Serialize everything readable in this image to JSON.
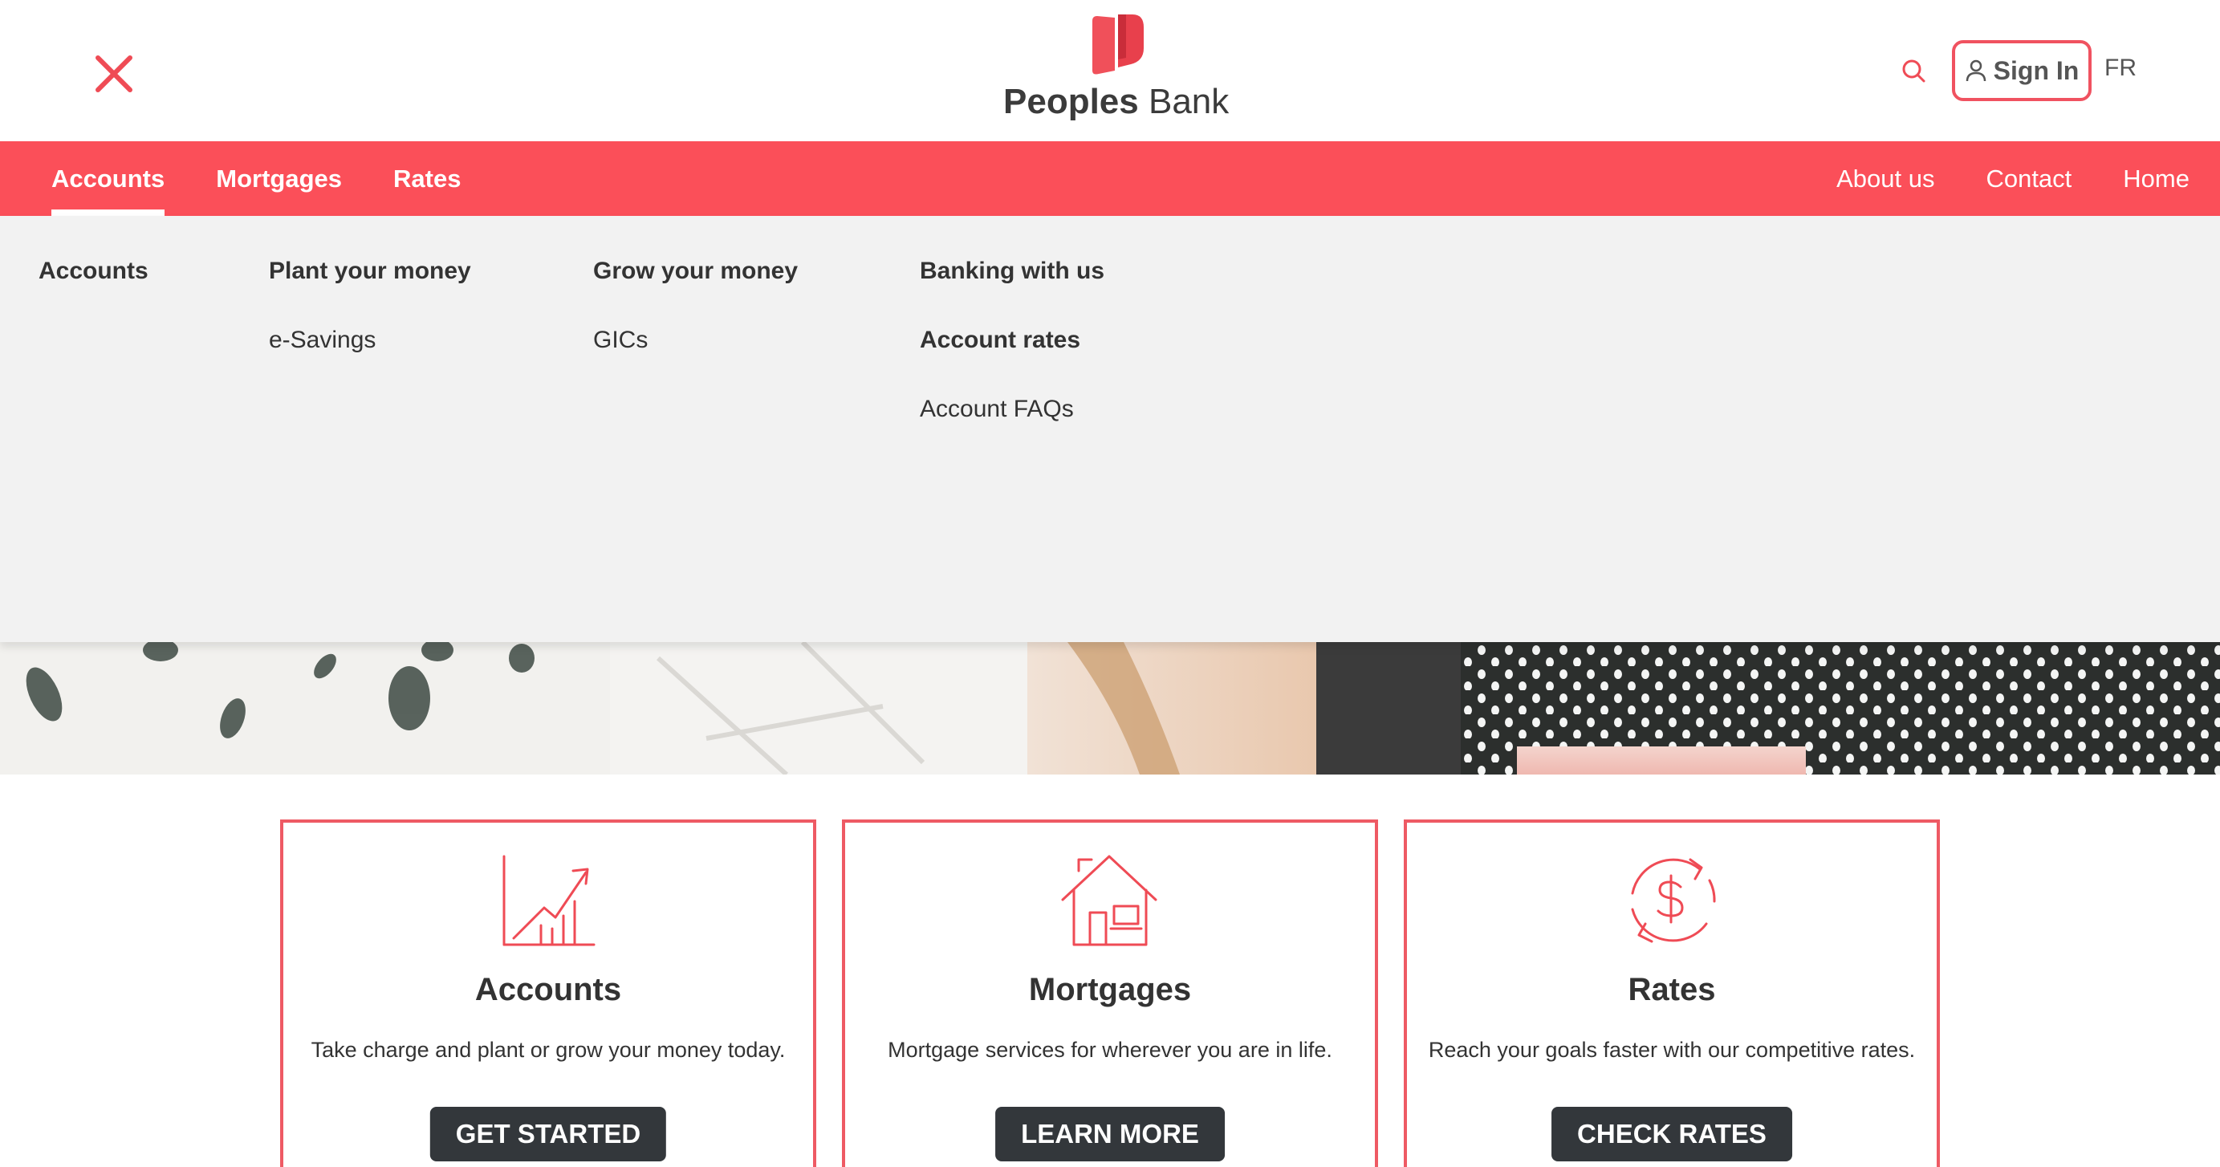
{
  "brand": {
    "name_bold": "Peoples",
    "name_light": "Bank",
    "accent_color": "#fb4f59",
    "logo_icon": "peoples-bank-logo-icon"
  },
  "header": {
    "close_icon": "close-icon",
    "search_icon": "search-icon",
    "signin_icon": "user-icon",
    "signin_label": "Sign In",
    "language": "FR"
  },
  "nav": {
    "left": [
      {
        "label": "Accounts",
        "active": true
      },
      {
        "label": "Mortgages"
      },
      {
        "label": "Rates"
      }
    ],
    "right": [
      {
        "label": "About us"
      },
      {
        "label": "Contact"
      },
      {
        "label": "Home"
      }
    ]
  },
  "mega_menu": {
    "columns": [
      {
        "heading": "Accounts",
        "links": []
      },
      {
        "heading": "Plant your money",
        "links": [
          "e-Savings"
        ]
      },
      {
        "heading": "Grow your money",
        "links": [
          "GICs"
        ]
      },
      {
        "heading": "Banking with us",
        "links": [
          "Account rates",
          "Account FAQs"
        ]
      }
    ]
  },
  "cards": [
    {
      "icon": "growth-chart-icon",
      "title": "Accounts",
      "description": "Take charge and plant or grow your money today.",
      "button": "GET STARTED"
    },
    {
      "icon": "house-icon",
      "title": "Mortgages",
      "description": "Mortgage services for wherever you are in life.",
      "button": "LEARN MORE"
    },
    {
      "icon": "dollar-refresh-icon",
      "title": "Rates",
      "description": "Reach your goals faster with our competitive rates.",
      "button": "CHECK RATES"
    }
  ]
}
